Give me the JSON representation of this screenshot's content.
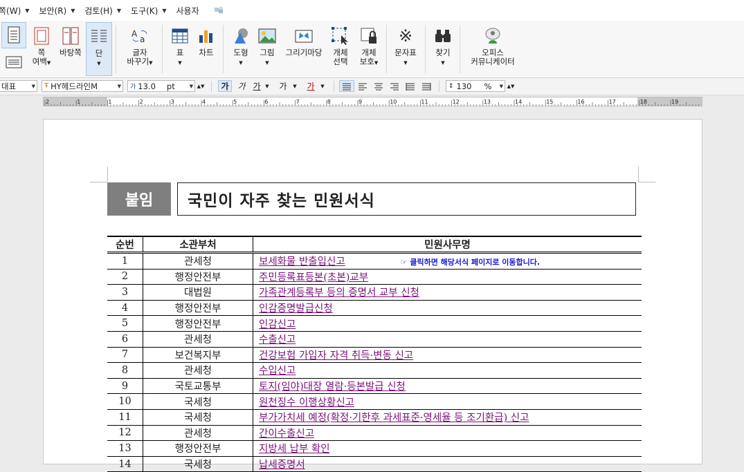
{
  "menu": {
    "items": [
      "쪽(W)",
      "보안(R)",
      "검토(H)",
      "도구(K)",
      "사용자"
    ]
  },
  "ribbon": {
    "page_margin": "쪽\n여백",
    "background": "바탕쪽",
    "column": "단",
    "char_change": "글자\n바꾸기",
    "table": "표",
    "chart": "차트",
    "shape": "도형",
    "picture": "그림",
    "drawing": "그리기마당",
    "obj_select": "개체\n선택",
    "obj_protect": "개체\n보호",
    "symbols": "문자표",
    "find": "찾기",
    "office_communicator": "오피스\n커뮤니케이터"
  },
  "format": {
    "style": "대표",
    "font": "HY헤드라인M",
    "size": "13.0",
    "unit": "pt",
    "bold": "가",
    "italic": "가",
    "underline": "가",
    "strike": "가",
    "color_char": "가",
    "line_spacing": "130",
    "percent": "%"
  },
  "ruler": {
    "ticks": [
      "2",
      "1",
      "1",
      "2",
      "3",
      "4",
      "5",
      "6",
      "7",
      "8",
      "9",
      "10",
      "11",
      "12",
      "13",
      "14",
      "15",
      "16",
      "17",
      "18",
      "19"
    ]
  },
  "doc": {
    "tag": "붙임",
    "title": "국민이 자주 찾는 민원서식",
    "hint": "클릭하면 해당서식 페이지로 이동합니다.",
    "headers": [
      "순번",
      "소관부처",
      "민원사무명"
    ],
    "rows": [
      {
        "no": "1",
        "dept": "관세청",
        "name": "보세화물 반출입신고"
      },
      {
        "no": "2",
        "dept": "행정안전부",
        "name": "주민등록표등본(초본)교부"
      },
      {
        "no": "3",
        "dept": "대법원",
        "name": "가족관계등록부 등의 증명서 교부 신청"
      },
      {
        "no": "4",
        "dept": "행정안전부",
        "name": "인감증명발급신청"
      },
      {
        "no": "5",
        "dept": "행정안전부",
        "name": "인감신고"
      },
      {
        "no": "6",
        "dept": "관세청",
        "name": "수출신고"
      },
      {
        "no": "7",
        "dept": "보건복지부",
        "name": "건강보험 가입자 자격 취득·변동 신고"
      },
      {
        "no": "8",
        "dept": "관세청",
        "name": "수입신고"
      },
      {
        "no": "9",
        "dept": "국토교통부",
        "name": "토지(임야)대장 열람·등본발급 신청"
      },
      {
        "no": "10",
        "dept": "국세청",
        "name": "원천징수 이행상황신고"
      },
      {
        "no": "11",
        "dept": "국세청",
        "name": "부가가치세 예정(확정·기한후 과세표준·영세율 등 조기환급) 신고"
      },
      {
        "no": "12",
        "dept": "관세청",
        "name": "간이수출신고"
      },
      {
        "no": "13",
        "dept": "행정안전부",
        "name": "지방세 납부 확인"
      },
      {
        "no": "14",
        "dept": "국세청",
        "name": "납세증명서"
      }
    ]
  }
}
